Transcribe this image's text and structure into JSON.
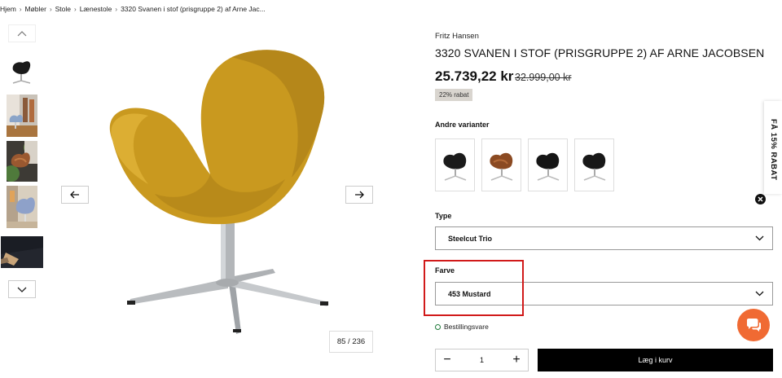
{
  "breadcrumb": [
    {
      "label": "Hjem"
    },
    {
      "label": "Møbler"
    },
    {
      "label": "Stole"
    },
    {
      "label": "Lænestole"
    },
    {
      "label": "3320 Svanen i stof (prisgruppe 2) af Arne Jac..."
    }
  ],
  "gallery": {
    "counter": "85 / 236",
    "thumbnails": [
      "black-swan-chair",
      "room-scene-blue-chair",
      "leather-swan-chair-greenery",
      "blue-swan-chair-scene",
      "dark-detail-photo"
    ],
    "main_image": "mustard-swan-chair"
  },
  "product": {
    "brand": "Fritz Hansen",
    "title": "3320 SVANEN I STOF (PRISGRUPPE 2) AF ARNE JACOBSEN",
    "price": "25.739,22 kr",
    "old_price": "32.999,00 kr",
    "discount": "22% rabat"
  },
  "variants": {
    "label": "Andre varianter",
    "items": [
      "black-chair",
      "cognac-leather-chair",
      "black-chair",
      "black-chair"
    ]
  },
  "type_select": {
    "label": "Type",
    "value": "Steelcut Trio"
  },
  "color_select": {
    "label": "Farve",
    "value": "453 Mustard"
  },
  "stock": {
    "label": "Bestillingsvare",
    "color": "#1e7a3a"
  },
  "quantity": {
    "value": "1",
    "minus": "−",
    "plus": "+"
  },
  "cart": {
    "label": "Læg i kurv"
  },
  "promo": {
    "label": "FÅ 15% RABAT"
  },
  "colors": {
    "accent": "#f06a33",
    "highlight": "#d11a1a",
    "button": "#000000",
    "badge": "#d9d5cf",
    "chair": "#c99a1e"
  }
}
